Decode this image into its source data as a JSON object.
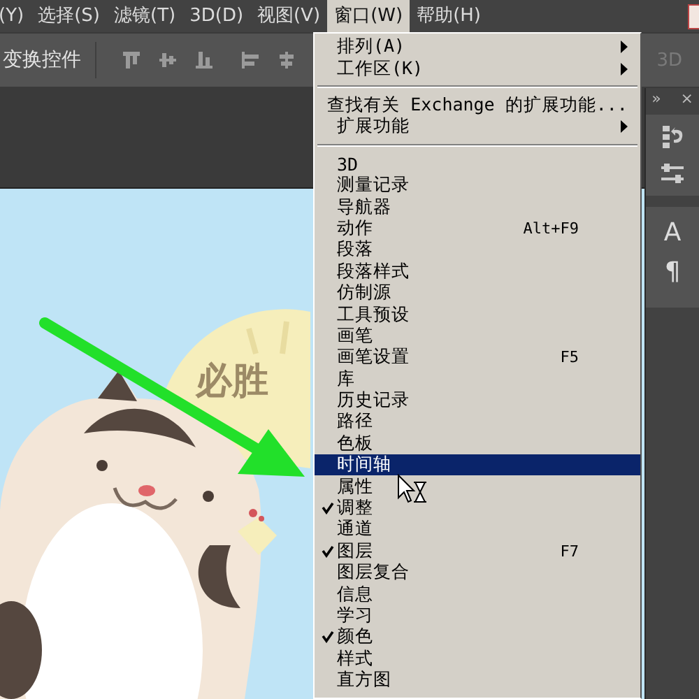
{
  "menu_bar": {
    "items": [
      {
        "label": "(Y)",
        "selected": false
      },
      {
        "label": "选择(S)",
        "selected": false
      },
      {
        "label": "滤镜(T)",
        "selected": false
      },
      {
        "label": "3D(D)",
        "selected": false
      },
      {
        "label": "视图(V)",
        "selected": false
      },
      {
        "label": "窗口(W)",
        "selected": true
      },
      {
        "label": "帮助(H)",
        "selected": false
      }
    ]
  },
  "options_bar": {
    "label": "变换控件",
    "disabled_label": "3D"
  },
  "canvas": {
    "artwork_text": "必胜"
  },
  "panel_dock": {
    "collapse_glyph": "»",
    "close_glyph": "×",
    "glyphs": [
      "A",
      "¶"
    ]
  },
  "window_menu": {
    "sections": [
      [
        {
          "label": "排列(A)",
          "has_submenu": true,
          "checked": false,
          "selected": false
        },
        {
          "label": "工作区(K)",
          "has_submenu": true,
          "checked": false,
          "selected": false
        }
      ],
      [
        {
          "label": "查找有关 Exchange 的扩展功能...",
          "has_submenu": false,
          "checked": false,
          "selected": false
        },
        {
          "label": "扩展功能",
          "has_submenu": true,
          "checked": false,
          "selected": false
        }
      ],
      [
        {
          "label": "3D",
          "has_submenu": false,
          "checked": false,
          "selected": false
        },
        {
          "label": "测量记录",
          "has_submenu": false,
          "checked": false,
          "selected": false
        },
        {
          "label": "导航器",
          "has_submenu": false,
          "checked": false,
          "selected": false
        },
        {
          "label": "动作",
          "has_submenu": false,
          "checked": false,
          "selected": false,
          "shortcut": "Alt+F9"
        },
        {
          "label": "段落",
          "has_submenu": false,
          "checked": false,
          "selected": false
        },
        {
          "label": "段落样式",
          "has_submenu": false,
          "checked": false,
          "selected": false
        },
        {
          "label": "仿制源",
          "has_submenu": false,
          "checked": false,
          "selected": false
        },
        {
          "label": "工具预设",
          "has_submenu": false,
          "checked": false,
          "selected": false
        },
        {
          "label": "画笔",
          "has_submenu": false,
          "checked": false,
          "selected": false
        },
        {
          "label": "画笔设置",
          "has_submenu": false,
          "checked": false,
          "selected": false,
          "shortcut": "F5"
        },
        {
          "label": "库",
          "has_submenu": false,
          "checked": false,
          "selected": false
        },
        {
          "label": "历史记录",
          "has_submenu": false,
          "checked": false,
          "selected": false
        },
        {
          "label": "路径",
          "has_submenu": false,
          "checked": false,
          "selected": false
        },
        {
          "label": "色板",
          "has_submenu": false,
          "checked": false,
          "selected": false
        },
        {
          "label": "时间轴",
          "has_submenu": false,
          "checked": false,
          "selected": true
        },
        {
          "label": "属性",
          "has_submenu": false,
          "checked": false,
          "selected": false
        },
        {
          "label": "调整",
          "has_submenu": false,
          "checked": true,
          "selected": false
        },
        {
          "label": "通道",
          "has_submenu": false,
          "checked": false,
          "selected": false
        },
        {
          "label": "图层",
          "has_submenu": false,
          "checked": true,
          "selected": false,
          "shortcut": "F7"
        },
        {
          "label": "图层复合",
          "has_submenu": false,
          "checked": false,
          "selected": false
        },
        {
          "label": "信息",
          "has_submenu": false,
          "checked": false,
          "selected": false
        },
        {
          "label": "学习",
          "has_submenu": false,
          "checked": false,
          "selected": false
        },
        {
          "label": "颜色",
          "has_submenu": false,
          "checked": true,
          "selected": false
        },
        {
          "label": "样式",
          "has_submenu": false,
          "checked": false,
          "selected": false
        },
        {
          "label": "直方图",
          "has_submenu": false,
          "checked": false,
          "selected": false
        }
      ]
    ]
  }
}
